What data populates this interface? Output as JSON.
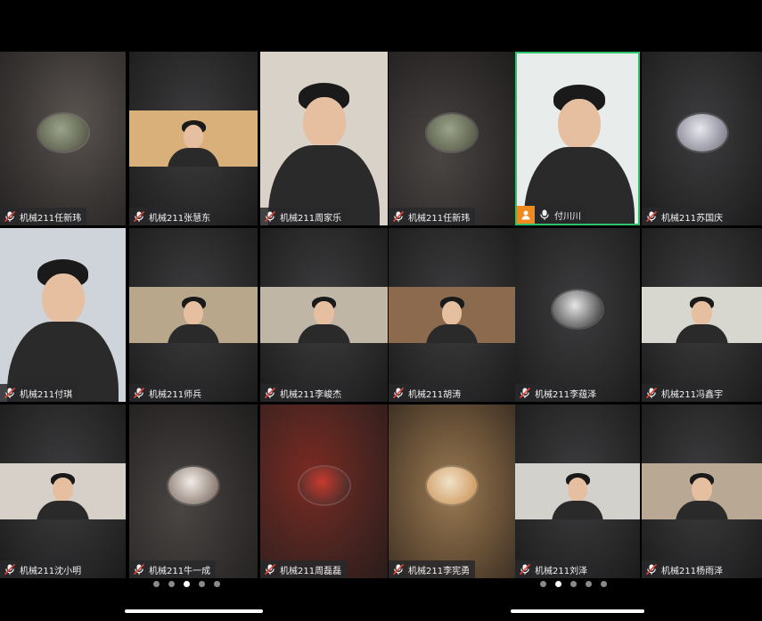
{
  "panels": [
    {
      "id": "left",
      "tiles": [
        {
          "name": "机械211任新玮",
          "kind": "avatar",
          "style": "blur1",
          "avatar_colors": [
            "#9aa48a",
            "#4a4a3a"
          ]
        },
        {
          "name": "机械211张慧东",
          "kind": "video-strip",
          "style": "blur-dark",
          "bg": "#d9b07a"
        },
        {
          "name": "机械211周家乐",
          "kind": "video-full",
          "style": "",
          "bg": "#d8d2c8",
          "host": false
        },
        {
          "name": "机械211任新玮",
          "kind": "avatar",
          "style": "blur2",
          "avatar_colors": [
            "#9aa48a",
            "#4a4a3a"
          ]
        },
        {
          "name": "机械211付琪",
          "kind": "video-full",
          "style": "",
          "bg": "#cfd3da"
        },
        {
          "name": "机械211师兵",
          "kind": "video-strip",
          "style": "blur-dark",
          "bg": "#b9a78c"
        },
        {
          "name": "机械211李峻杰",
          "kind": "video-strip",
          "style": "blur-dark",
          "bg": "#bfb6a6"
        },
        {
          "name": "机械211胡涛",
          "kind": "video-strip",
          "style": "blur-dark",
          "bg": "#8c6a4e"
        },
        {
          "name": "机械211沈小明",
          "kind": "video-strip",
          "style": "blur-dark",
          "bg": "#d6d0c8"
        },
        {
          "name": "机械211牛一成",
          "kind": "avatar",
          "style": "blur2",
          "avatar_colors": [
            "#f2ece6",
            "#6b5a50"
          ]
        },
        {
          "name": "机械211周磊磊",
          "kind": "avatar",
          "style": "blur-red",
          "avatar_colors": [
            "#c63a2e",
            "#2a2a2a"
          ]
        },
        {
          "name": "机械211李宪勇",
          "kind": "avatar",
          "style": "blur-tan",
          "avatar_colors": [
            "#f0e2c8",
            "#c88a4a"
          ]
        }
      ],
      "dots": 5,
      "active_dot": 2
    },
    {
      "id": "right",
      "tiles": [
        {
          "name": "付川川",
          "kind": "video-full",
          "style": "",
          "bg": "#e8ecea",
          "host": true,
          "active": true
        },
        {
          "name": "机械211苏国庆",
          "kind": "avatar",
          "style": "blur-dark",
          "avatar_colors": [
            "#e8e8ee",
            "#6a6a7a"
          ]
        },
        {
          "name": "机械211李蕴泽",
          "kind": "avatar",
          "style": "blur-dark",
          "avatar_colors": [
            "#e6e6e6",
            "#222222"
          ]
        },
        {
          "name": "机械211冯鑫宇",
          "kind": "video-strip",
          "style": "blur-dark",
          "bg": "#d7d6cf"
        },
        {
          "name": "机械211刘泽",
          "kind": "video-strip",
          "style": "blur-dark",
          "bg": "#d3d1cc"
        },
        {
          "name": "机械211杨雨泽",
          "kind": "video-strip",
          "style": "blur-dark",
          "bg": "#b8a894"
        }
      ],
      "dots": 5,
      "active_dot": 1
    }
  ],
  "colors": {
    "active_border": "#2ec26d",
    "host_badge": "#f08a1e",
    "mic_off": "#e0453a"
  },
  "icons": {
    "mic": "microphone-muted-icon",
    "host": "host-person-icon"
  }
}
